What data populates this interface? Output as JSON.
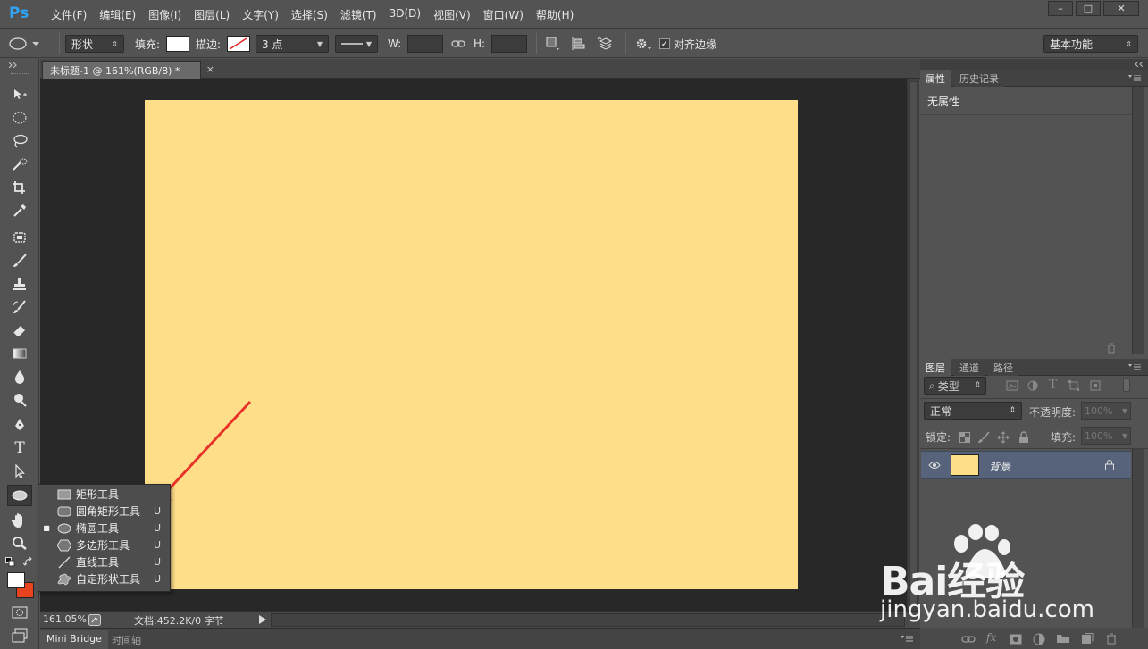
{
  "app": {
    "logo": "Ps",
    "menus": [
      "文件(F)",
      "编辑(E)",
      "图像(I)",
      "图层(L)",
      "文字(Y)",
      "选择(S)",
      "滤镜(T)",
      "3D(D)",
      "视图(V)",
      "窗口(W)",
      "帮助(H)"
    ],
    "window_buttons": [
      "–",
      "□",
      "✕"
    ]
  },
  "options": {
    "mode": "形状",
    "fill_label": "填充:",
    "stroke_label": "描边:",
    "stroke_width": "3 点",
    "w_label": "W:",
    "h_label": "H:",
    "align_edges": "对齐边缘",
    "align_checked": true,
    "workspace": "基本功能",
    "fill_color": "#ffffff"
  },
  "document": {
    "tab_title": "未标题-1 @ 161%(RGB/8) *",
    "close": "×",
    "canvas_color": "#ffde8a",
    "zoom": "161.05%",
    "doc_info": "文档:452.2K/0 字节"
  },
  "bottom_tabs": [
    "Mini Bridge",
    "时间轴"
  ],
  "flyout": {
    "items": [
      {
        "label": "矩形工具",
        "key": "",
        "icon": "rectangle-icon",
        "selected": false
      },
      {
        "label": "圆角矩形工具",
        "key": "U",
        "icon": "rounded-rectangle-icon",
        "selected": false
      },
      {
        "label": "椭圆工具",
        "key": "U",
        "icon": "ellipse-icon",
        "selected": true
      },
      {
        "label": "多边形工具",
        "key": "U",
        "icon": "polygon-icon",
        "selected": false
      },
      {
        "label": "直线工具",
        "key": "U",
        "icon": "line-icon",
        "selected": false
      },
      {
        "label": "自定形状工具",
        "key": "U",
        "icon": "custom-shape-icon",
        "selected": false
      }
    ]
  },
  "properties_panel": {
    "tabs": [
      "属性",
      "历史记录"
    ],
    "content": "无属性"
  },
  "layers_panel": {
    "tabs": [
      "图层",
      "通道",
      "路径"
    ],
    "filter_kind": "类型",
    "blend_mode": "正常",
    "opacity_label": "不透明度:",
    "opacity_value": "100%",
    "lock_label": "锁定:",
    "fill_label": "填充:",
    "fill_value": "100%",
    "layers": [
      {
        "name": "背景",
        "thumb_color": "#ffde8a",
        "visible": true,
        "locked": true
      }
    ]
  },
  "watermark": {
    "logo": "Bai经验",
    "url": "jingyan.baidu.com"
  },
  "accent": {
    "annotation_arrow": "#e8332a",
    "selection_blue": "#56637a"
  }
}
